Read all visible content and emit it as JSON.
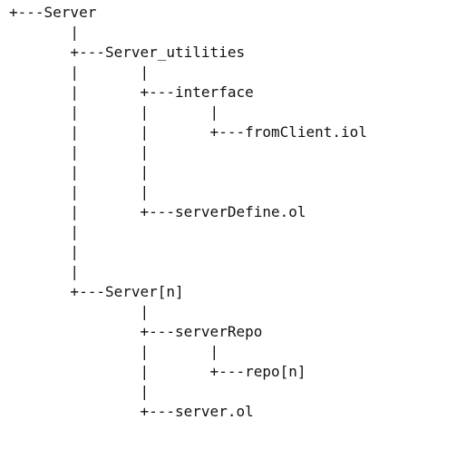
{
  "tree": {
    "lines": [
      "+---Server",
      "       |",
      "       +---Server_utilities",
      "       |       |",
      "       |       +---interface",
      "       |       |       |",
      "       |       |       +---fromClient.iol",
      "       |       |",
      "       |       |",
      "       |       |",
      "       |       +---serverDefine.ol",
      "       |",
      "       |",
      "       |",
      "       +---Server[n]",
      "               |",
      "               +---serverRepo",
      "               |       |",
      "               |       +---repo[n]",
      "               |",
      "               +---server.ol"
    ]
  }
}
